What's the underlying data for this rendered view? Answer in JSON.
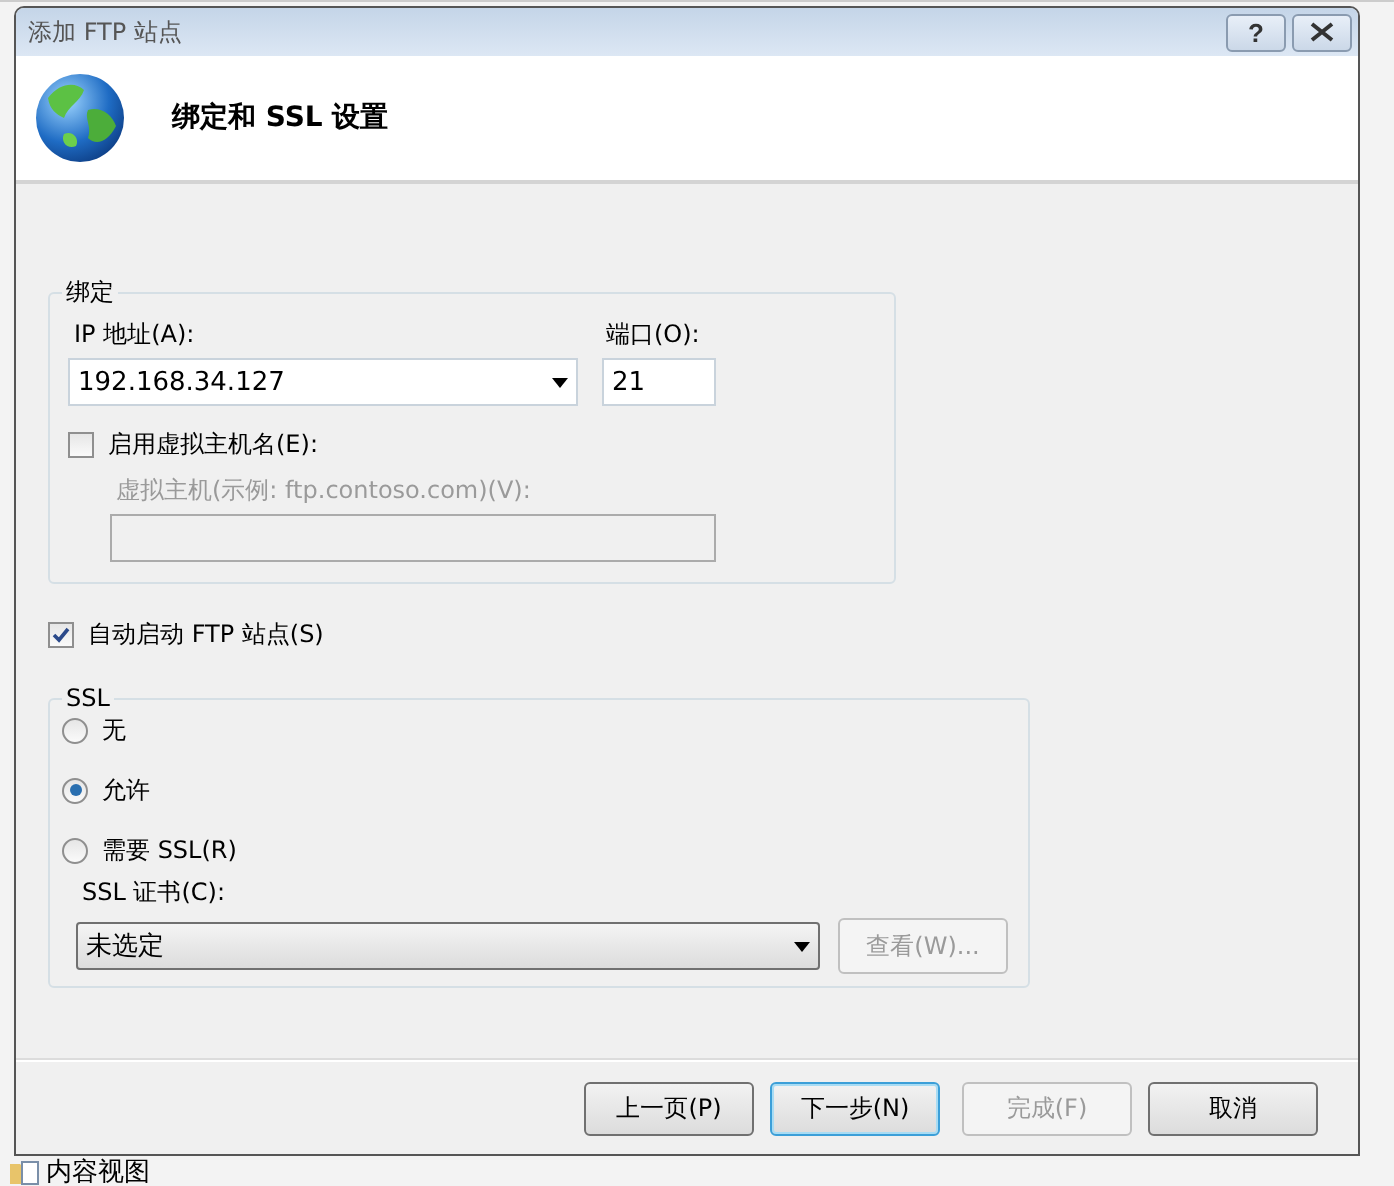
{
  "background_window": {
    "status_item": "内容视图"
  },
  "dialog": {
    "title": "添加 FTP 站点",
    "help_button": "?"
  },
  "header": {
    "heading": "绑定和 SSL 设置"
  },
  "binding": {
    "legend": "绑定",
    "ip_label": "IP 地址(A):",
    "ip_value": "192.168.34.127",
    "port_label": "端口(O):",
    "port_value": "21",
    "virtual_host": {
      "label": "启用虚拟主机名(E):",
      "checked": false
    },
    "host_field": {
      "label": "虚拟主机(示例: ftp.contoso.com)(V):",
      "disabled": true
    }
  },
  "auto_start": {
    "label": "自动启动 FTP 站点(S)",
    "checked": true
  },
  "ssl": {
    "legend": "SSL",
    "options": [
      {
        "label": "无",
        "selected": false
      },
      {
        "label": "允许",
        "selected": true
      },
      {
        "label": "需要 SSL(R)",
        "selected": false
      }
    ],
    "cert_label": "SSL 证书(C):",
    "cert_value": "未选定",
    "view_button": {
      "label": "查看(W)...",
      "disabled": true
    }
  },
  "buttons": [
    {
      "label": "上一页(P)",
      "disabled": false,
      "focused": false
    },
    {
      "label": "下一步(N)",
      "disabled": false,
      "focused": true
    },
    {
      "label": "完成(F)",
      "disabled": true,
      "focused": false
    },
    {
      "label": "取消",
      "disabled": false,
      "focused": false
    }
  ]
}
